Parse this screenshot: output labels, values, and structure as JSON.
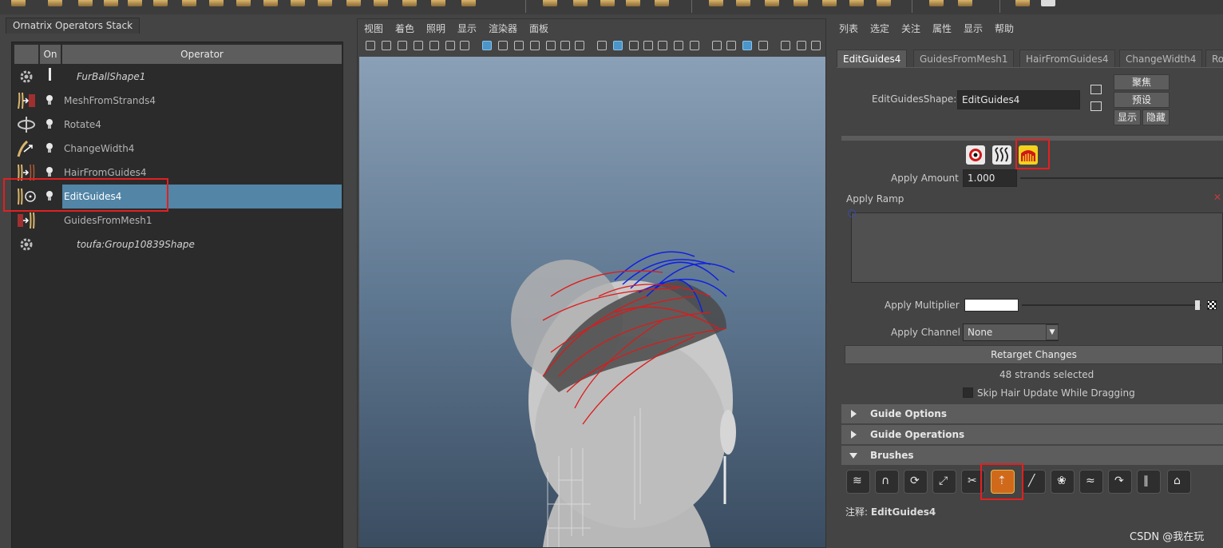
{
  "left_panel": {
    "tab_title": "Ornatrix Operators Stack",
    "headers": {
      "on": "On",
      "operator": "Operator"
    },
    "operators": [
      {
        "name": "FurBallShape1",
        "icon": "gear-icon"
      },
      {
        "name": "MeshFromStrands4",
        "icon": "mesh-from-strands-icon"
      },
      {
        "name": "Rotate4",
        "icon": "rotate-icon"
      },
      {
        "name": "ChangeWidth4",
        "icon": "change-width-icon"
      },
      {
        "name": "HairFromGuides4",
        "icon": "hair-from-guides-icon"
      },
      {
        "name": "EditGuides4",
        "icon": "edit-guides-icon",
        "selected": true
      },
      {
        "name": "GuidesFromMesh1",
        "icon": "guides-from-mesh-icon"
      },
      {
        "name": "toufa:Group10839Shape",
        "icon": "gear-icon"
      }
    ]
  },
  "viewport": {
    "menus": [
      "视图",
      "着色",
      "照明",
      "显示",
      "渲染器",
      "面板"
    ]
  },
  "attribute_editor": {
    "menus": [
      "列表",
      "选定",
      "关注",
      "属性",
      "显示",
      "帮助"
    ],
    "tabs": [
      "EditGuides4",
      "GuidesFromMesh1",
      "HairFromGuides4",
      "ChangeWidth4",
      "Ro"
    ],
    "shape_label": "EditGuidesShape:",
    "shape_value": "EditGuides4",
    "buttons": {
      "focus": "聚焦",
      "presets": "预设",
      "show": "显示",
      "hide": "隐藏"
    },
    "apply_amount_label": "Apply Amount",
    "apply_amount_value": "1.000",
    "apply_ramp_label": "Apply Ramp",
    "apply_multiplier_label": "Apply Multiplier",
    "apply_channel_label": "Apply Channel",
    "apply_channel_value": "None",
    "retarget_button": "Retarget Changes",
    "strands_status": "48 strands selected",
    "skip_update_label": "Skip Hair Update While Dragging",
    "sections": {
      "guide_options": "Guide Options",
      "guide_operations": "Guide Operations",
      "brushes": "Brushes"
    },
    "notes_label": "注释:",
    "notes_value": "EditGuides4"
  },
  "watermark": "CSDN @我在玩",
  "colors": {
    "selection": "#5285a6",
    "highlight_box": "#e32020",
    "active_brush": "#d06a1a"
  }
}
